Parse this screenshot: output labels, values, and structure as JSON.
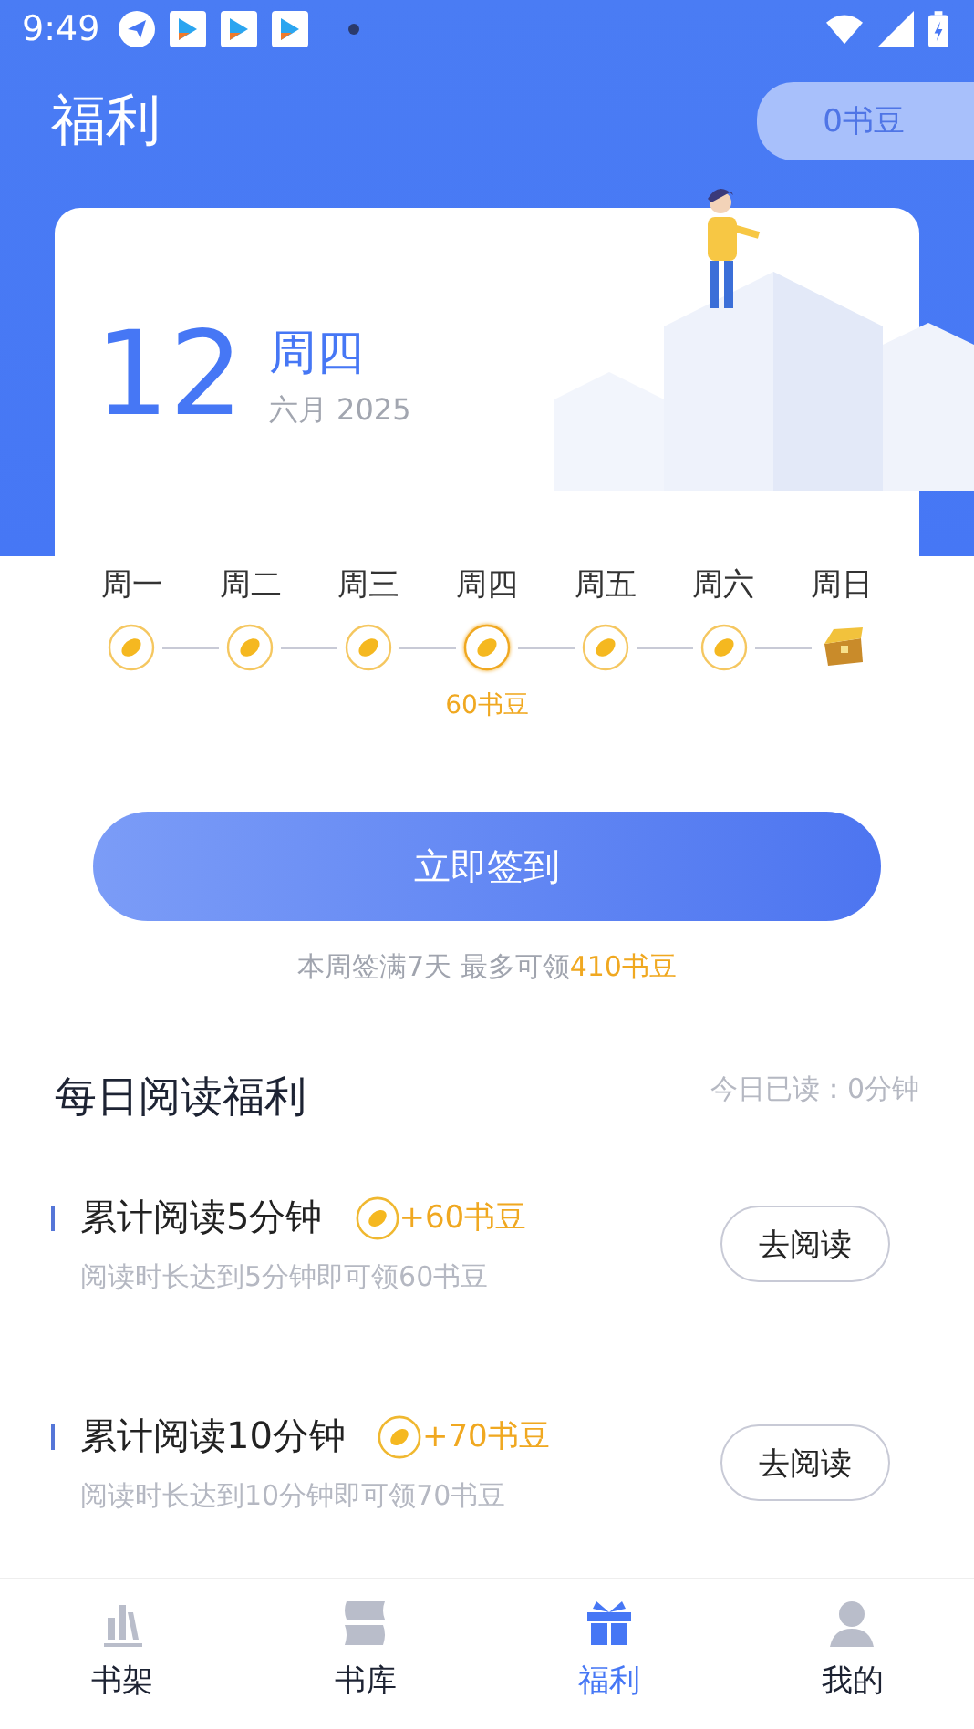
{
  "status_bar": {
    "time": "9:49"
  },
  "header": {
    "title": "福利",
    "balance": "0书豆"
  },
  "date": {
    "day": "12",
    "weekday": "周四",
    "month_year": "六月 2025"
  },
  "week": [
    {
      "label": "周一",
      "today": false,
      "kind": "bean"
    },
    {
      "label": "周二",
      "today": false,
      "kind": "bean"
    },
    {
      "label": "周三",
      "today": false,
      "kind": "bean"
    },
    {
      "label": "周四",
      "today": true,
      "kind": "bean",
      "reward": "60书豆"
    },
    {
      "label": "周五",
      "today": false,
      "kind": "bean"
    },
    {
      "label": "周六",
      "today": false,
      "kind": "bean"
    },
    {
      "label": "周日",
      "today": false,
      "kind": "chest"
    }
  ],
  "checkin_button": "立即签到",
  "checkin_note": "本周签满7天 最多可领**410书豆**",
  "reading": {
    "title": "每日阅读福利",
    "today_read": "今日已读：0分钟",
    "tasks": [
      {
        "title": "累计阅读5分钟",
        "reward": "+60书豆",
        "desc": "阅读时长达到5分钟即可领60书豆",
        "button": "去阅读"
      },
      {
        "title": "累计阅读10分钟",
        "reward": "+70书豆",
        "desc": "阅读时长达到10分钟即可领70书豆",
        "button": "去阅读"
      }
    ]
  },
  "tabs": [
    {
      "label": "书架",
      "kind": "shelf",
      "selected": false
    },
    {
      "label": "书库",
      "kind": "library",
      "selected": false
    },
    {
      "label": "福利",
      "kind": "gift",
      "selected": true
    },
    {
      "label": "我的",
      "kind": "person",
      "selected": false
    }
  ]
}
